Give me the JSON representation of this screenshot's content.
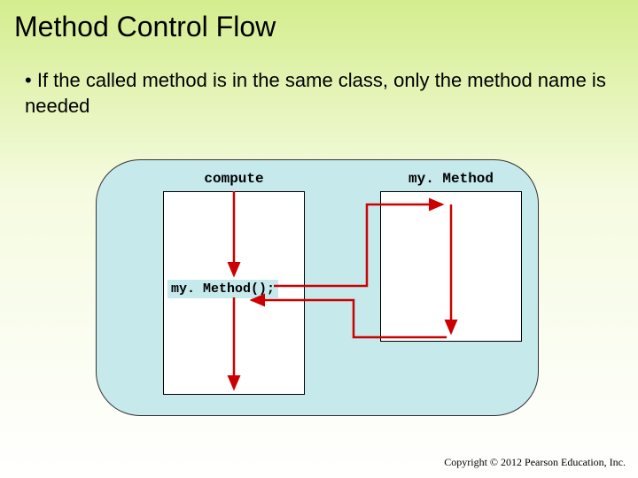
{
  "title": "Method Control Flow",
  "bullet": "If the called method is in the same class, only the method name is needed",
  "diagram": {
    "left_label": "compute",
    "right_label": "my. Method",
    "call_text": "my. Method();"
  },
  "copyright": "Copyright © 2012 Pearson Education, Inc."
}
